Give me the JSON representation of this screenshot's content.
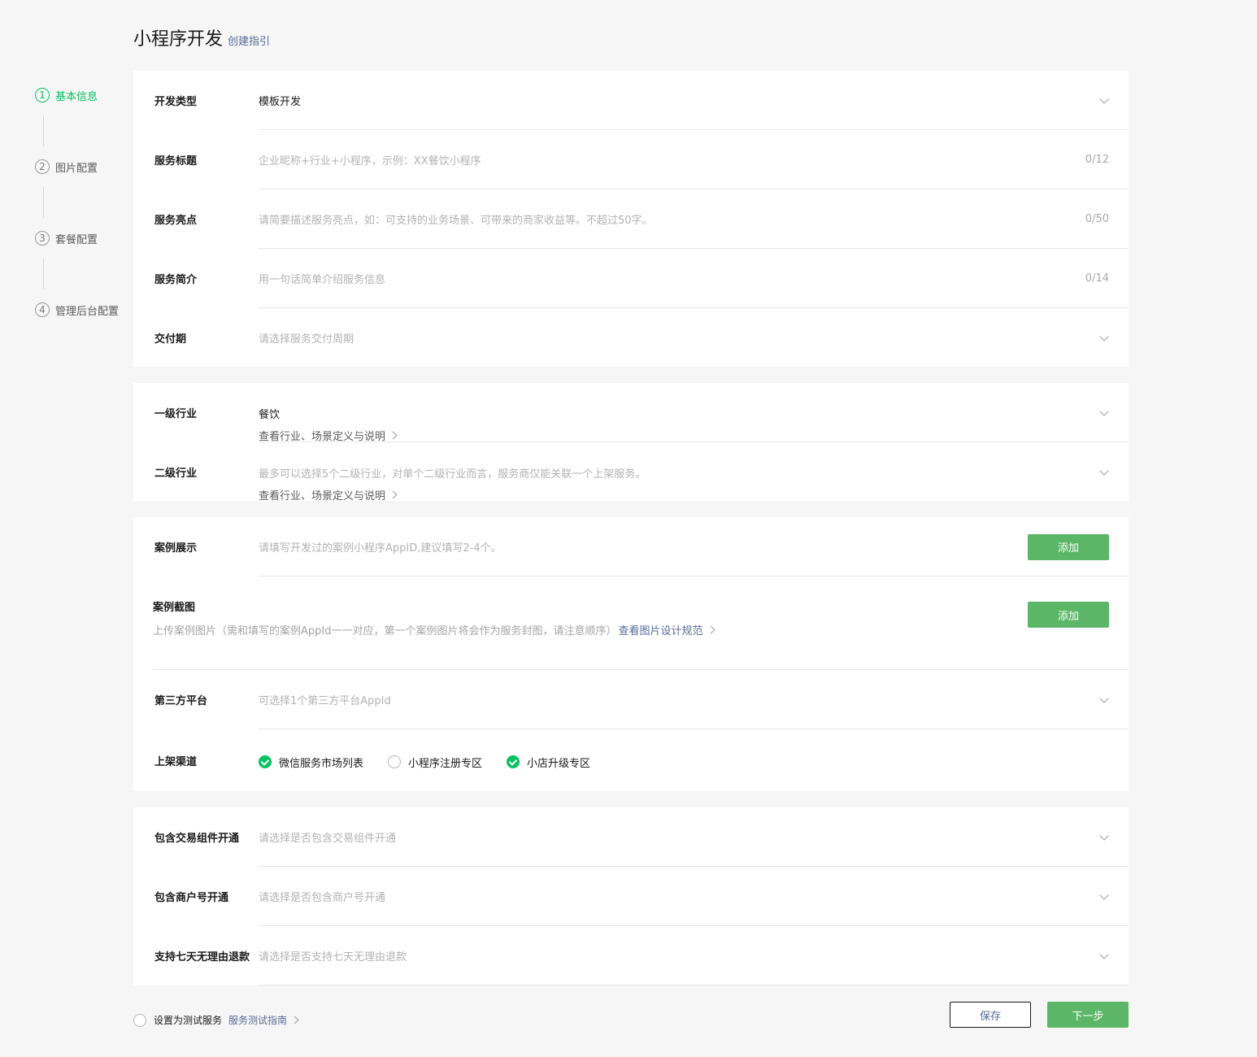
{
  "header": {
    "title": "小程序开发",
    "guide_link": "创建指引"
  },
  "steps": [
    {
      "num": "1",
      "label": "基本信息",
      "active": true
    },
    {
      "num": "2",
      "label": "图片配置"
    },
    {
      "num": "3",
      "label": "套餐配置"
    },
    {
      "num": "4",
      "label": "管理后台配置"
    }
  ],
  "basic": {
    "dev_type": {
      "label": "开发类型",
      "value": "模板开发"
    },
    "service_title": {
      "label": "服务标题",
      "placeholder": "企业昵称+行业+小程序，示例：XX餐饮小程序",
      "counter": "0/12"
    },
    "service_highlight": {
      "label": "服务亮点",
      "placeholder": "请简要描述服务亮点，如：可支持的业务场景、可带来的商家收益等。不超过50字。",
      "counter": "0/50"
    },
    "service_intro": {
      "label": "服务简介",
      "placeholder": "用一句话简单介绍服务信息",
      "counter": "0/14"
    },
    "delivery": {
      "label": "交付期",
      "placeholder": "请选择服务交付周期"
    }
  },
  "industry": {
    "level1": {
      "label": "一级行业",
      "value": "餐饮",
      "link": "查看行业、场景定义与说明"
    },
    "level2": {
      "label": "二级行业",
      "placeholder": "最多可以选择5个二级行业，对单个二级行业而言，服务商仅能关联一个上架服务。",
      "link": "查看行业、场景定义与说明"
    }
  },
  "cases": {
    "showcase": {
      "label": "案例展示",
      "placeholder": "请填写开发过的案例小程序AppID,建议填写2-4个。",
      "button": "添加"
    },
    "screenshot": {
      "label": "案例截图",
      "desc": "上传案例图片（需和填写的案例AppId一一对应，第一个案例图片将会作为服务封图，请注意顺序）",
      "link": "查看图片设计规范",
      "button": "添加"
    },
    "third_party": {
      "label": "第三方平台",
      "placeholder": "可选择1个第三方平台AppId"
    },
    "channels": {
      "label": "上架渠道",
      "options": [
        {
          "label": "微信服务市场列表",
          "checked": true
        },
        {
          "label": "小程序注册专区",
          "checked": false
        },
        {
          "label": "小店升级专区",
          "checked": true
        }
      ]
    }
  },
  "extras": {
    "trade": {
      "label": "包含交易组件开通",
      "placeholder": "请选择是否包含交易组件开通"
    },
    "merchant": {
      "label": "包含商户号开通",
      "placeholder": "请选择是否包含商户号开通"
    },
    "refund": {
      "label": "支持七天无理由退款",
      "placeholder": "请选择是否支持七天无理由退款"
    }
  },
  "footer": {
    "test_label": "设置为测试服务",
    "test_link": "服务测试指南",
    "save": "保存",
    "next": "下一步"
  },
  "colors": {
    "accent_green": "#07c160",
    "button_green": "#5bb767",
    "link_blue": "#576b95"
  }
}
